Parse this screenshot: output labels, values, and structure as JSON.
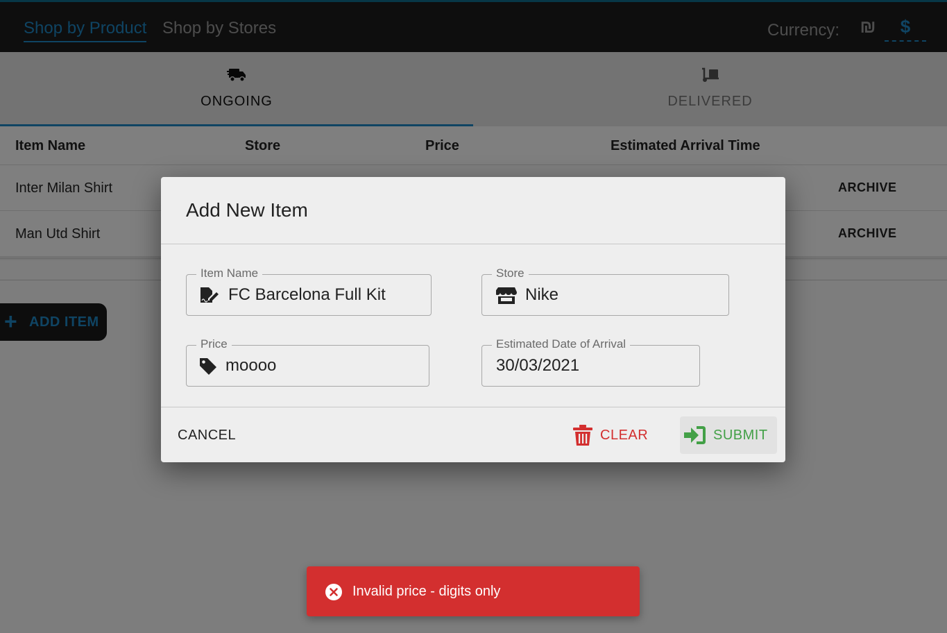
{
  "nav": {
    "links": [
      {
        "label": "Shop by Product",
        "active": true
      },
      {
        "label": "Shop by Stores",
        "active": false
      }
    ],
    "currency_label": "Currency:",
    "currencies": [
      {
        "symbol": "₪",
        "active": false
      },
      {
        "symbol": "$",
        "active": true
      }
    ],
    "accent_color": "#1e88c7"
  },
  "tabs": [
    {
      "label": "ONGOING",
      "icon": "shipping-truck-icon",
      "active": true
    },
    {
      "label": "DELIVERED",
      "icon": "dolly-icon",
      "active": false
    }
  ],
  "table": {
    "columns": [
      "Item Name",
      "Store",
      "Price",
      "Estimated Arrival Time"
    ],
    "rows": [
      {
        "name": "Inter Milan Shirt",
        "action": "ARCHIVE"
      },
      {
        "name": "Man Utd Shirt",
        "action": "ARCHIVE"
      }
    ]
  },
  "add_item": {
    "label": "ADD ITEM",
    "icon": "plus-icon"
  },
  "dialog": {
    "title": "Add New Item",
    "fields": {
      "item_name": {
        "label": "Item Name",
        "value": "FC Barcelona Full Kit",
        "icon": "file-signature-icon"
      },
      "store": {
        "label": "Store",
        "value": "Nike",
        "icon": "store-icon"
      },
      "price": {
        "label": "Price",
        "value": "moooo",
        "icon": "tag-icon"
      },
      "arrival": {
        "label": "Estimated Date of Arrival",
        "value": "30/03/2021"
      }
    },
    "buttons": {
      "cancel": "CANCEL",
      "clear": "CLEAR",
      "submit": "SUBMIT"
    },
    "colors": {
      "clear": "#d32f2f",
      "submit": "#43a047"
    }
  },
  "snackbar": {
    "message": "Invalid price - digits only",
    "icon": "error-circle-icon",
    "color": "#d32f2f"
  }
}
